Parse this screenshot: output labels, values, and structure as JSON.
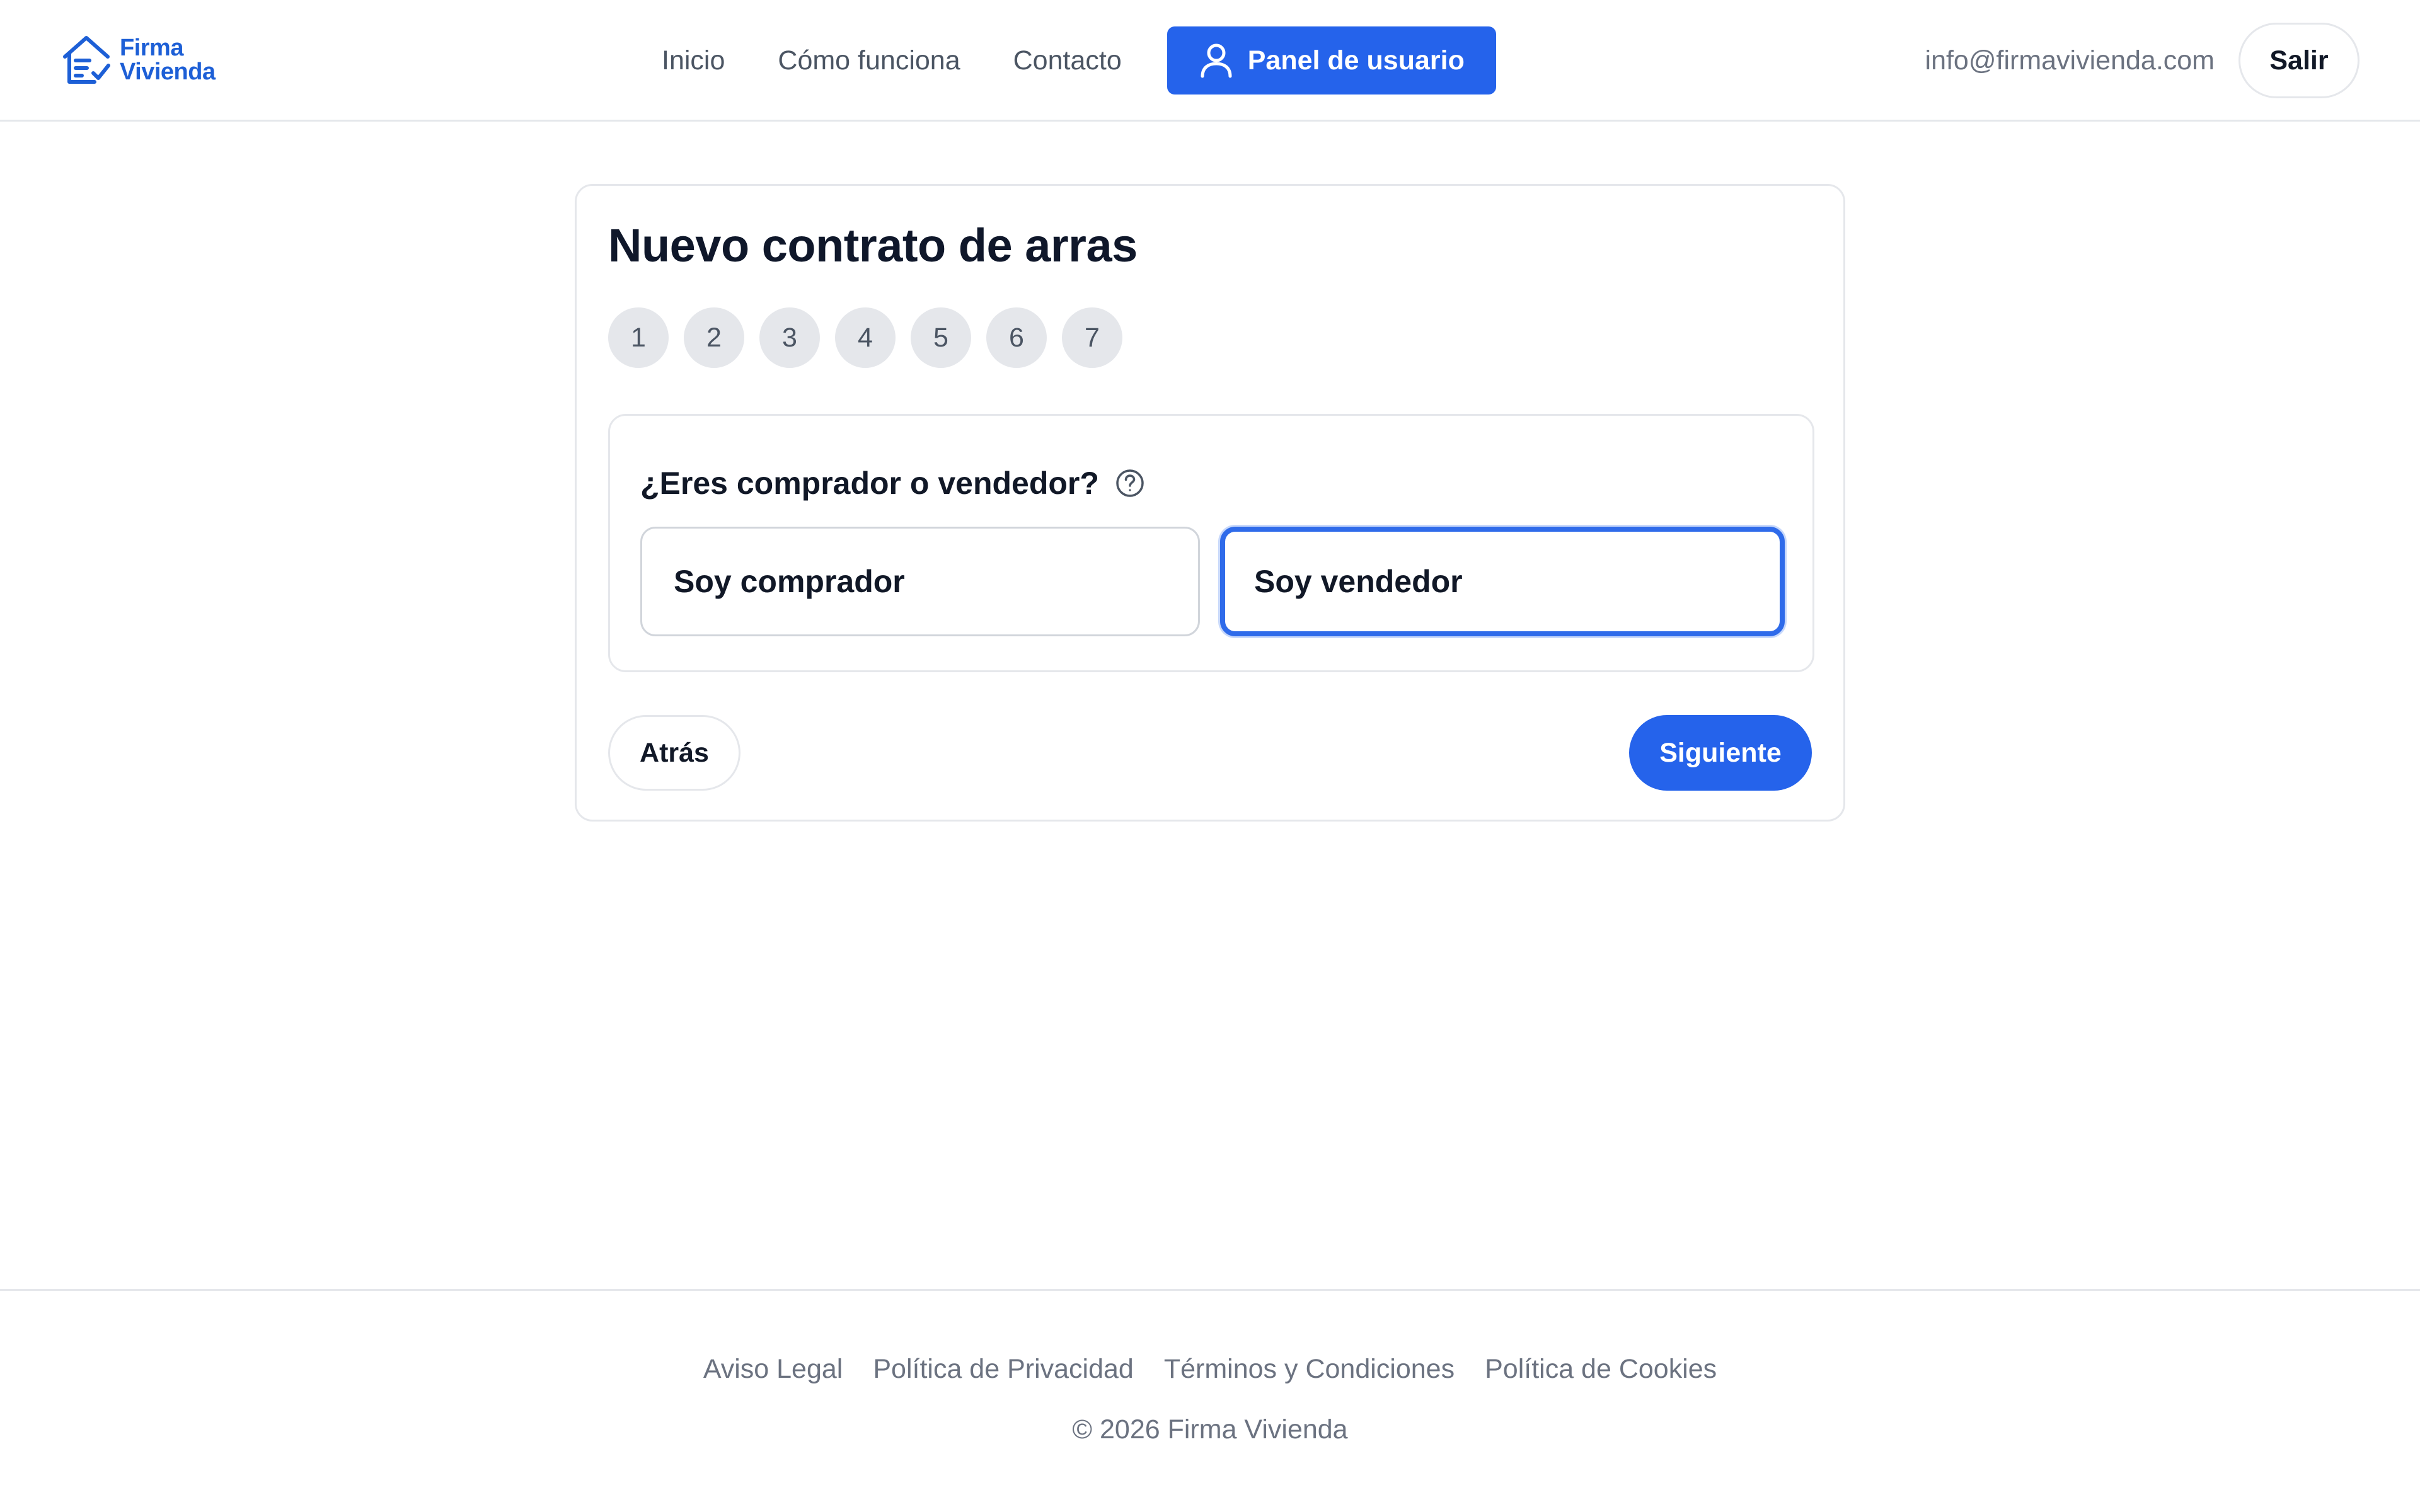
{
  "brand": {
    "name_line1": "Firma",
    "name_line2": "Vivienda",
    "logo_icon": "house-document-icon"
  },
  "nav": {
    "links": [
      "Inicio",
      "Cómo funciona",
      "Contacto"
    ],
    "panel_button": "Panel de usuario",
    "panel_icon": "user-icon"
  },
  "header": {
    "email": "info@firmavivienda.com",
    "logout_label": "Salir"
  },
  "wizard": {
    "title": "Nuevo contrato de arras",
    "steps": [
      "1",
      "2",
      "3",
      "4",
      "5",
      "6",
      "7"
    ],
    "question": "¿Eres comprador o vendedor?",
    "help_icon": "help-circle-icon",
    "options": {
      "buyer": "Soy comprador",
      "seller": "Soy vendedor"
    },
    "selected_option": "seller",
    "back_label": "Atrás",
    "next_label": "Siguiente"
  },
  "footer": {
    "links": [
      "Aviso Legal",
      "Política de Privacidad",
      "Términos y Condiciones",
      "Política de Cookies"
    ],
    "copyright": "© 2026 Firma Vivienda"
  },
  "colors": {
    "accent": "#2563eb",
    "brand": "#1d5fd6",
    "border": "#e5e7eb",
    "muted_text": "#6b7280"
  }
}
